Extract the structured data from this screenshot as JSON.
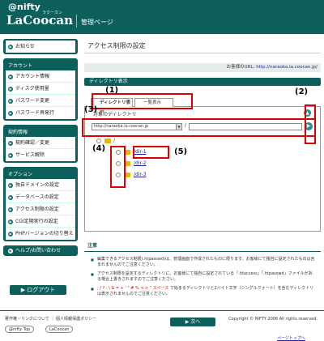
{
  "header": {
    "nifty": "@nifty",
    "lacoocan": "LaCoocan",
    "kana": "ラクーカン",
    "title": "管理ページ"
  },
  "sidebar": {
    "notice": "お知らせ",
    "account": {
      "title": "アカウント",
      "items": [
        "アカウント情報",
        "ディスク使用量",
        "パスワード変更",
        "パスワード再発行"
      ]
    },
    "contract": {
      "title": "契約情報",
      "items": [
        "契約確認／変更",
        "サービス解除"
      ]
    },
    "option": {
      "title": "オプション",
      "items": [
        "独自ドメインの設定",
        "データベースの設定",
        "アクセス制限の設定",
        "CGI定期実行の設定",
        "PHPバージョンの切り替え"
      ]
    },
    "help": "ヘルプ/お問い合わせ",
    "logout": "ログアウト"
  },
  "main": {
    "title": "アクセス制限の設定",
    "url_label": "お客様のURL:",
    "url_value": "http://naraoka.la.coocan.jp/",
    "section": "ディレクトリ表示",
    "tab_tree": "ディレクトリ表示",
    "tab_list": "一覧表示",
    "choose": "対象のディレクトリ",
    "host": "http://naraoka.la.coocan.jp",
    "slash": "/",
    "root": "/",
    "dirs": [
      "/dir-1",
      "/dir-2",
      "/dir-3"
    ],
    "note_title": "注意",
    "notes": [
      "編集できるアクセス制限(.htpasswd)は、管理画面で作成されたものに限ります。お客様にて独自に設定されたものは含まれませんのでご注意ください。",
      "アクセス制限を設定するディレクトリに、お客様にて独自に設定されている「.htaccess」「.htpasswd」ファイルがある場合上書きされますのでご注意ください。",
      "で始まるディレクトリと2バイト文字（シングルクォート）を含むディレクトリは表示されませんのでご注意ください。"
    ],
    "note_chars": "; / ? : \\ & = + ' \" # % < > \" スペース",
    "next": "次へ",
    "page_top": "ページトップへ"
  },
  "annotations": [
    "(1)",
    "(2)",
    "(3)",
    "(4)",
    "(5)"
  ],
  "footer": {
    "links": "著作権・リンクについて ｜ 個人情報保護ポリシー",
    "copyright": "Copyright © NIFTY 2006 All rights reserved.",
    "badge1": "@nifty Top",
    "badge2": "LaCoocan"
  },
  "colors": {
    "brand": "#0d5f5b",
    "annotation": "#dd0000",
    "link": "#2222aa"
  }
}
